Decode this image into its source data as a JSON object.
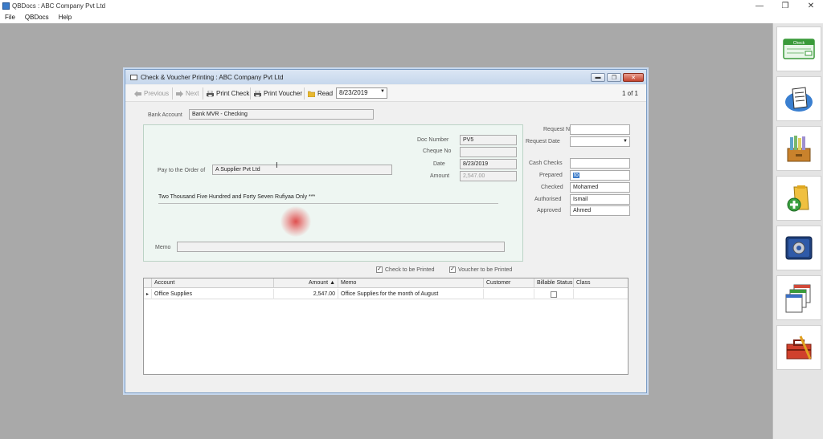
{
  "app": {
    "title": "QBDocs : ABC Company Pvt Ltd",
    "menu": [
      "File",
      "QBDocs",
      "Help"
    ],
    "window_controls": {
      "minimize": "—",
      "restore": "❐",
      "close": "✕"
    }
  },
  "dialog": {
    "title": "Check & Voucher Printing : ABC Company Pvt Ltd",
    "toolbar": {
      "previous": "Previous",
      "next": "Next",
      "print_check": "Print Check",
      "print_voucher": "Print Voucher",
      "read": "Read",
      "date": "8/23/2019",
      "pager": "1  of 1"
    },
    "bank_account": {
      "label": "Bank Account",
      "value": "Bank MVR - Checking"
    },
    "check": {
      "doc_number": {
        "label": "Doc Number",
        "value": "PV5"
      },
      "cheque_no": {
        "label": "Cheque No",
        "value": ""
      },
      "date": {
        "label": "Date",
        "value": "8/23/2019"
      },
      "amount": {
        "label": "Amount",
        "value": "2,547.00"
      },
      "pay_to": {
        "label": "Pay to the Order of",
        "value": "A Supplier Pvt Ltd"
      },
      "amount_words": "Two Thousand Five Hundred and Forty Seven Rufiyaa Only ***",
      "memo": {
        "label": "Memo",
        "value": ""
      }
    },
    "right_fields": {
      "request_no": {
        "label": "Request No",
        "value": ""
      },
      "request_date": {
        "label": "Request Date",
        "value": ""
      },
      "cash_checks": {
        "label": "Cash Checks",
        "value": ""
      },
      "prepared": {
        "label": "Prepared",
        "value": "to"
      },
      "checked": {
        "label": "Checked",
        "value": "Mohamed"
      },
      "authorised": {
        "label": "Authorised",
        "value": "Ismail"
      },
      "approved": {
        "label": "Approved",
        "value": "Ahmed"
      }
    },
    "flags": {
      "check_to_be_printed": {
        "label": "Check to be Printed",
        "checked": true
      },
      "voucher_to_be_printed": {
        "label": "Voucher to be Printed",
        "checked": true
      }
    },
    "grid": {
      "columns": [
        "Account",
        "Amount ▲",
        "Memo",
        "Customer",
        "Billable Status",
        "Class"
      ],
      "rows": [
        {
          "account": "Office Supplies",
          "amount": "2,547.00",
          "memo": "Office Supplies for the month of August",
          "customer": "",
          "billable": false,
          "class": ""
        }
      ]
    }
  },
  "side_panel": {
    "icons": [
      "check-icon",
      "receipt-icon",
      "file-cabinet-icon",
      "add-folder-icon",
      "settings-gear-icon",
      "windows-icon",
      "toolbox-icon"
    ],
    "check_icon_label": "Check"
  },
  "colors": {
    "accent": "#3b7bc9",
    "workspace": "#a9a9a9",
    "check_area": "#eef6f2",
    "close_button": "#c4442e"
  }
}
